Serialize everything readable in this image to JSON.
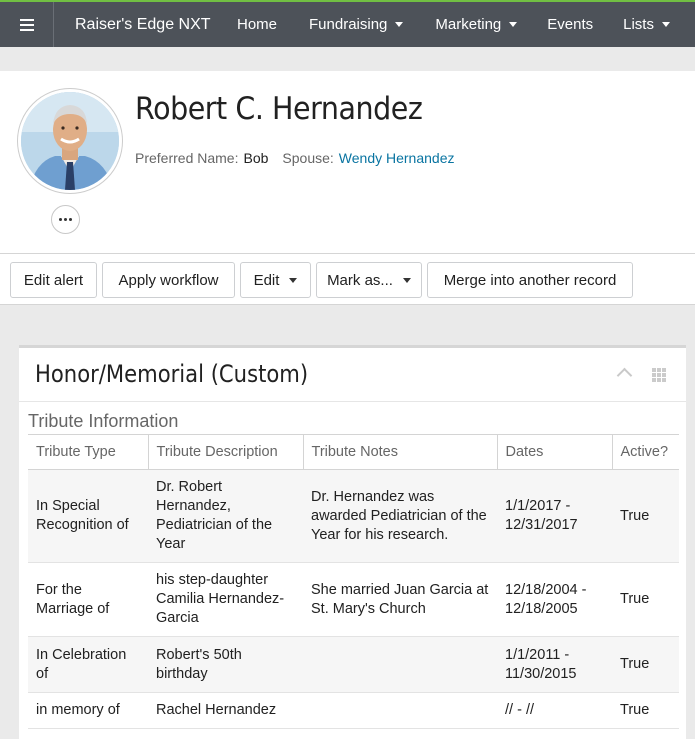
{
  "nav": {
    "brand": "Raiser's Edge NXT",
    "items": [
      {
        "label": "Home"
      },
      {
        "label": "Fundraising"
      },
      {
        "label": "Marketing"
      },
      {
        "label": "Events"
      },
      {
        "label": "Lists"
      }
    ]
  },
  "record": {
    "name": "Robert C. Hernandez",
    "preferred_name_label": "Preferred Name:",
    "preferred_name": "Bob",
    "spouse_label": "Spouse:",
    "spouse": "Wendy Hernandez"
  },
  "toolbar": {
    "edit_alert": "Edit alert",
    "apply_workflow": "Apply workflow",
    "edit": "Edit",
    "mark_as": "Mark as...",
    "merge": "Merge into another record"
  },
  "tile": {
    "title": "Honor/Memorial (Custom)",
    "section": "Tribute Information",
    "columns": [
      "Tribute Type",
      "Tribute Description",
      "Tribute Notes",
      "Dates",
      "Active?"
    ],
    "rows": [
      {
        "type": "In Special Recognition of",
        "description": "Dr. Robert Hernandez, Pediatrician of the Year",
        "notes": "Dr. Hernandez was awarded Pediatrician of the Year for his research.",
        "dates": "1/1/2017 - 12/31/2017",
        "active": "True"
      },
      {
        "type": "For the Marriage of",
        "description": "his step-daughter Camilia Hernandez-Garcia",
        "notes": "She married Juan Garcia at St. Mary's Church",
        "dates": "12/18/2004 - 12/18/2005",
        "active": "True"
      },
      {
        "type": "In Celebration of",
        "description": "Robert's 50th birthday",
        "notes": "",
        "dates": "1/1/2011 - 11/30/2015",
        "active": "True"
      },
      {
        "type": "in memory of",
        "description": "Rachel Hernandez",
        "notes": "",
        "dates": "// - //",
        "active": "True"
      }
    ]
  },
  "colors": {
    "nav_bg": "#4d5259",
    "nav_accent": "#71bf43",
    "link": "#0974a1"
  },
  "icons": [
    "hamburger-menu-icon",
    "chevron-down-icon",
    "ellipsis-icon",
    "chevron-up-icon",
    "grid-icon"
  ]
}
